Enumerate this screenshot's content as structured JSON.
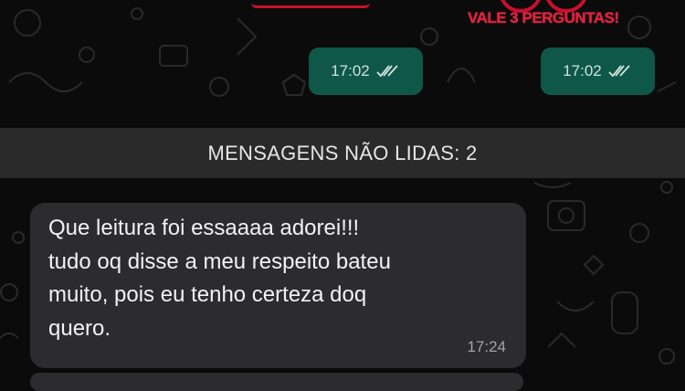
{
  "sticker": {
    "caption": "VALE 3 PERGUNTAS!"
  },
  "outgoing_messages": [
    {
      "time": "17:02",
      "status_icon": "double-check-icon"
    },
    {
      "time": "17:02",
      "status_icon": "double-check-icon"
    }
  ],
  "unread_banner": {
    "label": "MENSAGENS NÃO LIDAS: 2"
  },
  "incoming_message": {
    "lines": [
      "Que leitura foi essaaaa adorei!!!",
      "tudo oq disse a meu respeito bateu",
      "muito, pois eu tenho certeza doq",
      "quero."
    ],
    "time": "17:24"
  },
  "colors": {
    "background": "#0b0b0b",
    "outgoing_bubble": "#0f5849",
    "incoming_bubble": "#2c2c2e",
    "unread_bar": "#2a2a2a",
    "sticker_red": "#e0203a"
  }
}
